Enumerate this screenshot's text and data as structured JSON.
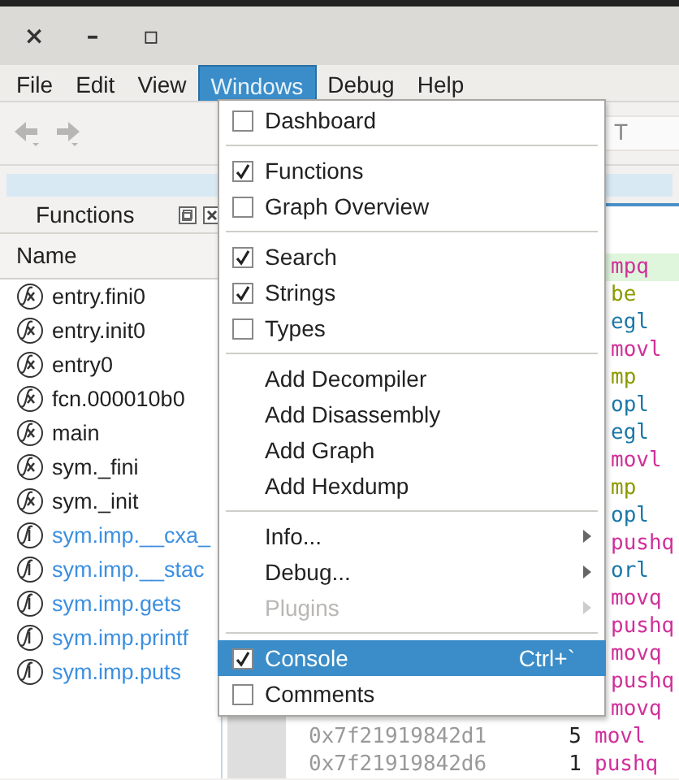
{
  "window": {
    "controls": [
      "×",
      "–",
      "▫"
    ]
  },
  "menubar": [
    {
      "label": "File",
      "selected": false
    },
    {
      "label": "Edit",
      "selected": false
    },
    {
      "label": "View",
      "selected": false
    },
    {
      "label": "Windows",
      "selected": true
    },
    {
      "label": "Debug",
      "selected": false
    },
    {
      "label": "Help",
      "selected": false
    }
  ],
  "toolbar": {
    "search_placeholder": "T"
  },
  "functions_dock": {
    "title": "Functions",
    "column": "Name",
    "items": [
      {
        "name": "entry.fini0",
        "kind": "local"
      },
      {
        "name": "entry.init0",
        "kind": "local"
      },
      {
        "name": "entry0",
        "kind": "local"
      },
      {
        "name": "fcn.000010b0",
        "kind": "local"
      },
      {
        "name": "main",
        "kind": "local"
      },
      {
        "name": "sym._fini",
        "kind": "local"
      },
      {
        "name": "sym._init",
        "kind": "local"
      },
      {
        "name": "sym.imp.__cxa_",
        "kind": "import"
      },
      {
        "name": "sym.imp.__stac",
        "kind": "import"
      },
      {
        "name": "sym.imp.gets",
        "kind": "import"
      },
      {
        "name": "sym.imp.printf",
        "kind": "import"
      },
      {
        "name": "sym.imp.puts",
        "kind": "import"
      }
    ]
  },
  "disassembly": {
    "rows": [
      {
        "mnemonic": "mpq",
        "color": "#d0309a",
        "current": true
      },
      {
        "mnemonic": "be",
        "color": "#8c9a00",
        "current": false
      },
      {
        "mnemonic": "egl",
        "color": "#1a78a8",
        "current": false
      },
      {
        "mnemonic": "movl",
        "color": "#d0309a",
        "current": false
      },
      {
        "mnemonic": "mp",
        "color": "#8c9a00",
        "current": false
      },
      {
        "mnemonic": "opl",
        "color": "#1a78a8",
        "current": false
      },
      {
        "mnemonic": "egl",
        "color": "#1a78a8",
        "current": false
      },
      {
        "mnemonic": "movl",
        "color": "#d0309a",
        "current": false
      },
      {
        "mnemonic": "mp",
        "color": "#8c9a00",
        "current": false
      },
      {
        "mnemonic": "opl",
        "color": "#1a78a8",
        "current": false
      },
      {
        "mnemonic": "pushq",
        "color": "#d0309a",
        "current": false
      },
      {
        "mnemonic": "orl",
        "color": "#1a78a8",
        "current": false
      },
      {
        "mnemonic": "movq",
        "color": "#d0309a",
        "current": false
      },
      {
        "mnemonic": "pushq",
        "color": "#d0309a",
        "current": false
      },
      {
        "mnemonic": "movq",
        "color": "#d0309a",
        "current": false
      },
      {
        "mnemonic": "pushq",
        "color": "#d0309a",
        "current": false
      },
      {
        "mnemonic": "movq",
        "color": "#d0309a",
        "current": false
      },
      {
        "address": "0x7f21919842d1",
        "size": "5",
        "mnemonic": "movl",
        "color": "#d0309a",
        "current": false
      },
      {
        "address": "0x7f21919842d6",
        "size": "1",
        "mnemonic": "pushq",
        "color": "#d0309a",
        "current": false
      }
    ]
  },
  "windows_menu": [
    {
      "kind": "check",
      "label": "Dashboard",
      "checked": false,
      "selected": false
    },
    {
      "kind": "separator"
    },
    {
      "kind": "check",
      "label": "Functions",
      "checked": true,
      "selected": false
    },
    {
      "kind": "check",
      "label": "Graph Overview",
      "checked": false,
      "selected": false
    },
    {
      "kind": "separator"
    },
    {
      "kind": "check",
      "label": "Search",
      "checked": true,
      "selected": false
    },
    {
      "kind": "check",
      "label": "Strings",
      "checked": true,
      "selected": false
    },
    {
      "kind": "check",
      "label": "Types",
      "checked": false,
      "selected": false
    },
    {
      "kind": "separator"
    },
    {
      "kind": "action",
      "label": "Add Decompiler",
      "selected": false
    },
    {
      "kind": "action",
      "label": "Add Disassembly",
      "selected": false
    },
    {
      "kind": "action",
      "label": "Add Graph",
      "selected": false
    },
    {
      "kind": "action",
      "label": "Add Hexdump",
      "selected": false
    },
    {
      "kind": "separator"
    },
    {
      "kind": "submenu",
      "label": "Info...",
      "disabled": false,
      "selected": false
    },
    {
      "kind": "submenu",
      "label": "Debug...",
      "disabled": false,
      "selected": false
    },
    {
      "kind": "submenu",
      "label": "Plugins",
      "disabled": true,
      "selected": false
    },
    {
      "kind": "separator"
    },
    {
      "kind": "check",
      "label": "Console",
      "checked": true,
      "selected": true,
      "shortcut": "Ctrl+`"
    },
    {
      "kind": "check",
      "label": "Comments",
      "checked": false,
      "selected": false
    }
  ]
}
